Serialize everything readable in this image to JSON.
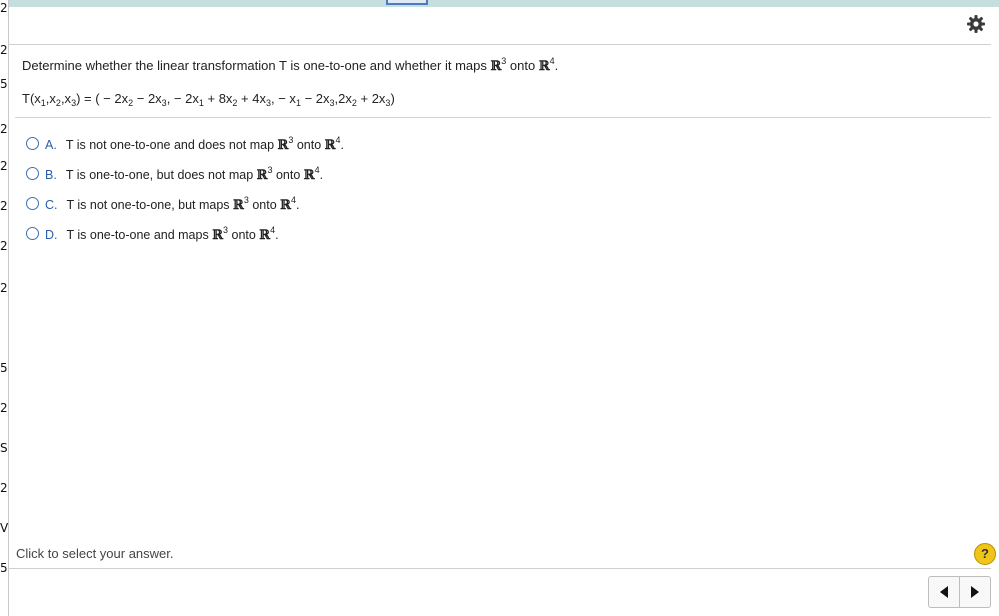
{
  "left_margin": [
    "2",
    "2",
    "5",
    "2",
    "2",
    "2",
    "2",
    "2",
    "5",
    "2",
    "S",
    "2",
    "V",
    "5"
  ],
  "question": {
    "prefix": "Determine whether the linear transformation T is one-to-one and whether it maps ",
    "r": "ℝ",
    "exp3": "3",
    "onto": " onto ",
    "exp4": "4",
    "suffix": "."
  },
  "formula": {
    "lhs": "T(x",
    "s1": "1",
    "c1": ",x",
    "s2": "2",
    "c2": ",x",
    "s3": "3",
    "eq": ") = ( − 2x",
    "t1s": "2",
    "t1b": " − 2x",
    "t1c": "3",
    "t2a": ", − 2x",
    "t2b": "1",
    "t2c": " + 8x",
    "t2d": "2",
    "t2e": " + 4x",
    "t2f": "3",
    "t3a": ", − x",
    "t3b": "1",
    "t3c": " − 2x",
    "t3d": "3",
    "t4a": ",2x",
    "t4b": "2",
    "t4c": " + 2x",
    "t4d": "3",
    "end": ")"
  },
  "choices": [
    {
      "letter": "A.",
      "text": "T is not one-to-one and does not map ",
      "onto": " onto ",
      "end": "."
    },
    {
      "letter": "B.",
      "text": "T is one-to-one, but does not map ",
      "onto": " onto ",
      "end": "."
    },
    {
      "letter": "C.",
      "text": "T is not one-to-one, but maps ",
      "onto": " onto ",
      "end": "."
    },
    {
      "letter": "D.",
      "text": "T is one-to-one and maps ",
      "onto": " onto ",
      "end": "."
    }
  ],
  "hint": "Click to select your answer.",
  "help_label": "?",
  "icons": {
    "gear": "gear-icon",
    "help": "help-icon",
    "prev": "arrow-left-icon",
    "next": "arrow-right-icon"
  }
}
